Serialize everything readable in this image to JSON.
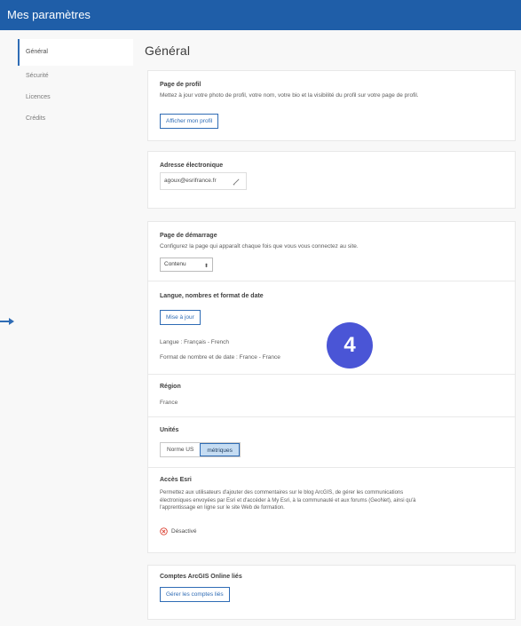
{
  "header": {
    "title": "Mes paramètres"
  },
  "sidebar": {
    "items": [
      {
        "label": "Général"
      },
      {
        "label": "Sécurité"
      },
      {
        "label": "Licences"
      },
      {
        "label": "Crédits"
      }
    ]
  },
  "main": {
    "title": "Général",
    "profile": {
      "title": "Page de profil",
      "description": "Mettez à jour votre photo de profil, votre nom, votre bio et la visibilité du profil sur votre page de profil.",
      "button": "Afficher mon profil"
    },
    "email": {
      "title": "Adresse électronique",
      "value": "agoux@esrifrance.fr"
    },
    "startup": {
      "title": "Page de démarrage",
      "description": "Configurez la page qui apparaît chaque fois que vous vous connectez au site.",
      "selected": "Contenu"
    },
    "language": {
      "title": "Langue, nombres et format de date",
      "button": "Mise à jour",
      "language_text": "Langue : Français - French",
      "format_text": "Format de nombre et de date : France - France"
    },
    "region": {
      "title": "Région",
      "value": "France"
    },
    "units": {
      "title": "Unités",
      "options": [
        "Norme US",
        "métriques"
      ],
      "selected": "métriques"
    },
    "esri_access": {
      "title": "Accès Esri",
      "description_line1": "Permettez aux utilisateurs d'ajouter des commentaires sur le blog ArcGIS, de gérer les communications",
      "description_line2": "électroniques envoyées par Esri et d'accéder à My Esri, à la communauté et aux forums (GeoNet), ainsi qu'à",
      "description_line3": "l'apprentissage en ligne sur le site Web de formation.",
      "status": "Désactivé"
    },
    "linked_accounts": {
      "title": "Comptes ArcGIS Online liés",
      "button": "Gérer les comptes liés"
    }
  },
  "annotation": {
    "number": "4",
    "color": "#4a55d6"
  },
  "colors": {
    "header": "#1f5ea8",
    "accent": "#2f6cb5"
  }
}
